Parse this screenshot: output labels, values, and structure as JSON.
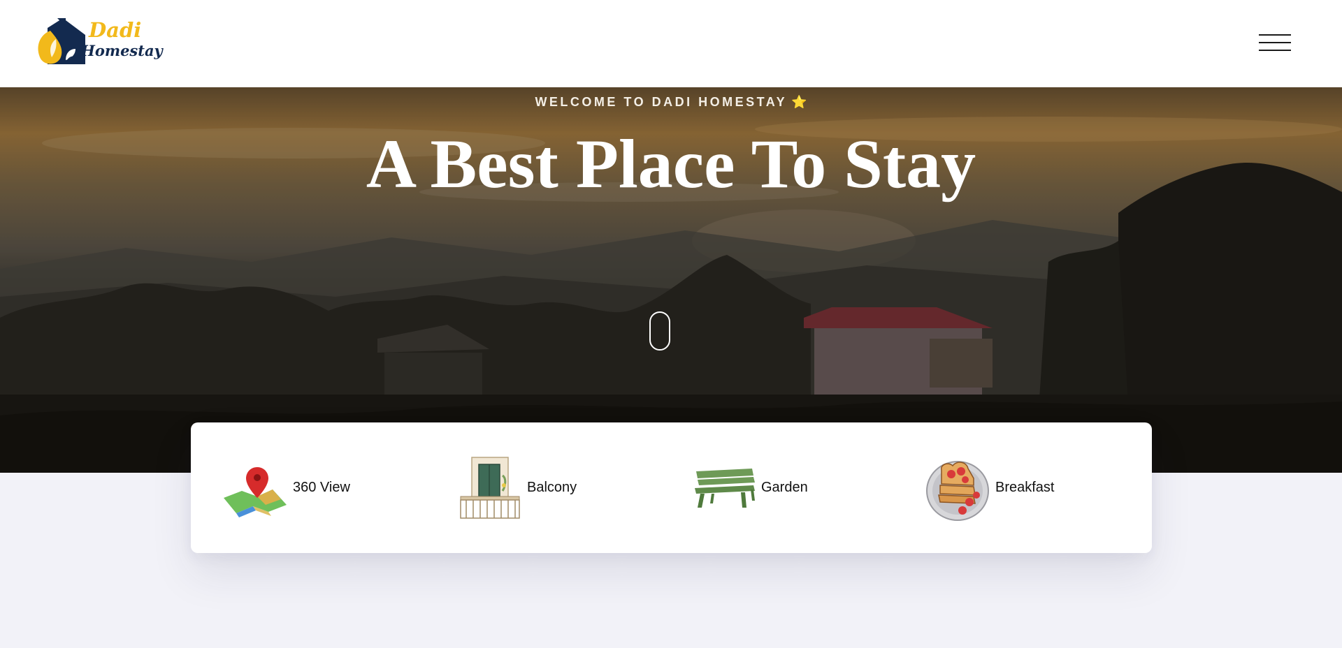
{
  "brand": {
    "name_line1": "Dadi",
    "name_line2": "Homestay",
    "logo_icon": "house-leaf-logo",
    "colors": {
      "navy": "#132a4f",
      "gold": "#f2b91b"
    }
  },
  "header": {
    "menu_icon": "hamburger-menu-icon"
  },
  "hero": {
    "welcome_text": "WELCOME TO DADI HOMESTAY",
    "welcome_icon": "star-icon",
    "welcome_icon_glyph": "⭐",
    "headline": "A Best Place To Stay",
    "scroll_icon": "scroll-mouse-icon"
  },
  "features": [
    {
      "label": "360 View",
      "icon": "map-pin-icon"
    },
    {
      "label": "Balcony",
      "icon": "balcony-icon"
    },
    {
      "label": "Garden",
      "icon": "garden-bench-icon"
    },
    {
      "label": "Breakfast",
      "icon": "breakfast-toast-icon"
    }
  ],
  "colors": {
    "page_background": "#f2f2f8",
    "card_background": "#ffffff",
    "accent_star": "#f5a623"
  }
}
